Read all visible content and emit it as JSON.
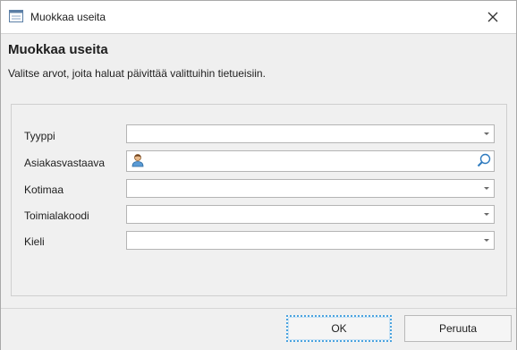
{
  "window": {
    "title": "Muokkaa useita",
    "icon": "form-window-icon",
    "close_icon": "close-icon"
  },
  "header": {
    "title": "Muokkaa useita",
    "subtitle": "Valitse arvot, joita haluat päivittää valittuihin tietueisiin."
  },
  "form": {
    "fields": [
      {
        "label": "Tyyppi",
        "type": "dropdown",
        "value": ""
      },
      {
        "label": "Asiakasvastaava",
        "type": "lookup",
        "value": "",
        "icons": [
          "person-icon",
          "search-icon"
        ]
      },
      {
        "label": "Kotimaa",
        "type": "dropdown",
        "value": ""
      },
      {
        "label": "Toimialakoodi",
        "type": "dropdown",
        "value": ""
      },
      {
        "label": "Kieli",
        "type": "dropdown",
        "value": ""
      }
    ]
  },
  "footer": {
    "ok_label": "OK",
    "cancel_label": "Peruuta"
  },
  "colors": {
    "header_band": "#efefef",
    "content_bg": "#f0f0f0",
    "focus_border": "#4aa3df"
  }
}
